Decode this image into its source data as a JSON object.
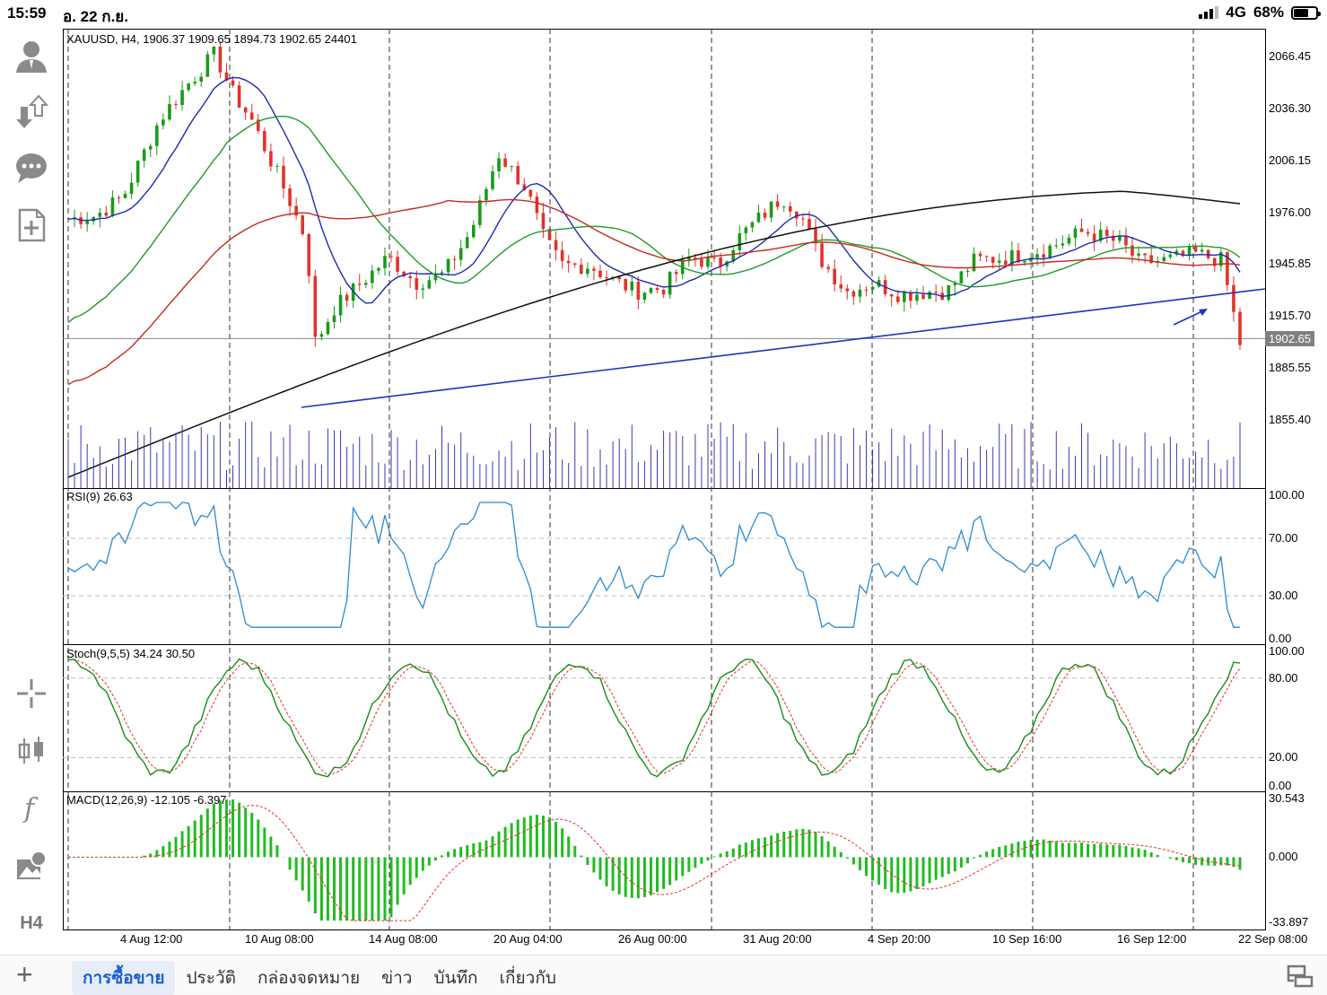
{
  "status_bar": {
    "time": "15:59",
    "date": "อ. 22 ก.ย.",
    "network": "4G",
    "battery": "68%"
  },
  "chart": {
    "symbol_line": "XAUUSD, H4, 1906.37 1909.65 1894.73 1902.65 24401",
    "current_price": "1902.65",
    "price_ticks": [
      "2066.45",
      "2036.30",
      "2006.15",
      "1976.00",
      "1945.85",
      "1915.70",
      "1885.55",
      "1855.40"
    ],
    "time_ticks": [
      "4 Aug 12:00",
      "10 Aug 08:00",
      "14 Aug 08:00",
      "20 Aug 04:00",
      "26 Aug 00:00",
      "31 Aug 20:00",
      "4 Sep 20:00",
      "10 Sep 16:00",
      "16 Sep 12:00",
      "22 Sep 08:00"
    ],
    "rsi_label": "RSI(9) 26.63",
    "rsi_ticks": [
      "100.00",
      "70.00",
      "30.00",
      "0.00"
    ],
    "stoch_label": "Stoch(9,5,5) 34.24 30.50",
    "stoch_ticks": [
      "100.00",
      "80.00",
      "20.00",
      "0.00"
    ],
    "macd_label": "MACD(12,26,9) -12.105 -6.397",
    "macd_ticks": [
      "30.543",
      "0.000",
      "-33.897"
    ],
    "colors": {
      "bull": "#1a9a1a",
      "bear": "#e0332a",
      "ma_fast": "#1f2ab0",
      "ma_mid": "#1f9a2a",
      "ma_slow": "#c8281e",
      "ma_long": "#111111",
      "trend": "#2030c0",
      "volume": "#3a3ab0",
      "rsi": "#2a8ad0",
      "stoch_main": "#1a8a1a",
      "stoch_signal": "#e0332a",
      "macd_hist": "#22bb22"
    }
  },
  "left_tools": [
    {
      "name": "account-icon"
    },
    {
      "name": "trade-icon"
    },
    {
      "name": "chat-icon"
    },
    {
      "name": "new-doc-icon"
    },
    {
      "name": "crosshair-icon"
    },
    {
      "name": "candles-icon"
    },
    {
      "name": "indicator-icon"
    },
    {
      "name": "objects-icon"
    },
    {
      "name": "timeframe-button",
      "label": "H4"
    }
  ],
  "tabs": [
    "การซื้อขาย",
    "ประวัติ",
    "กล่องจดหมาย",
    "ข่าว",
    "บันทึก",
    "เกี่ยวกับ"
  ],
  "active_tab": 0
}
